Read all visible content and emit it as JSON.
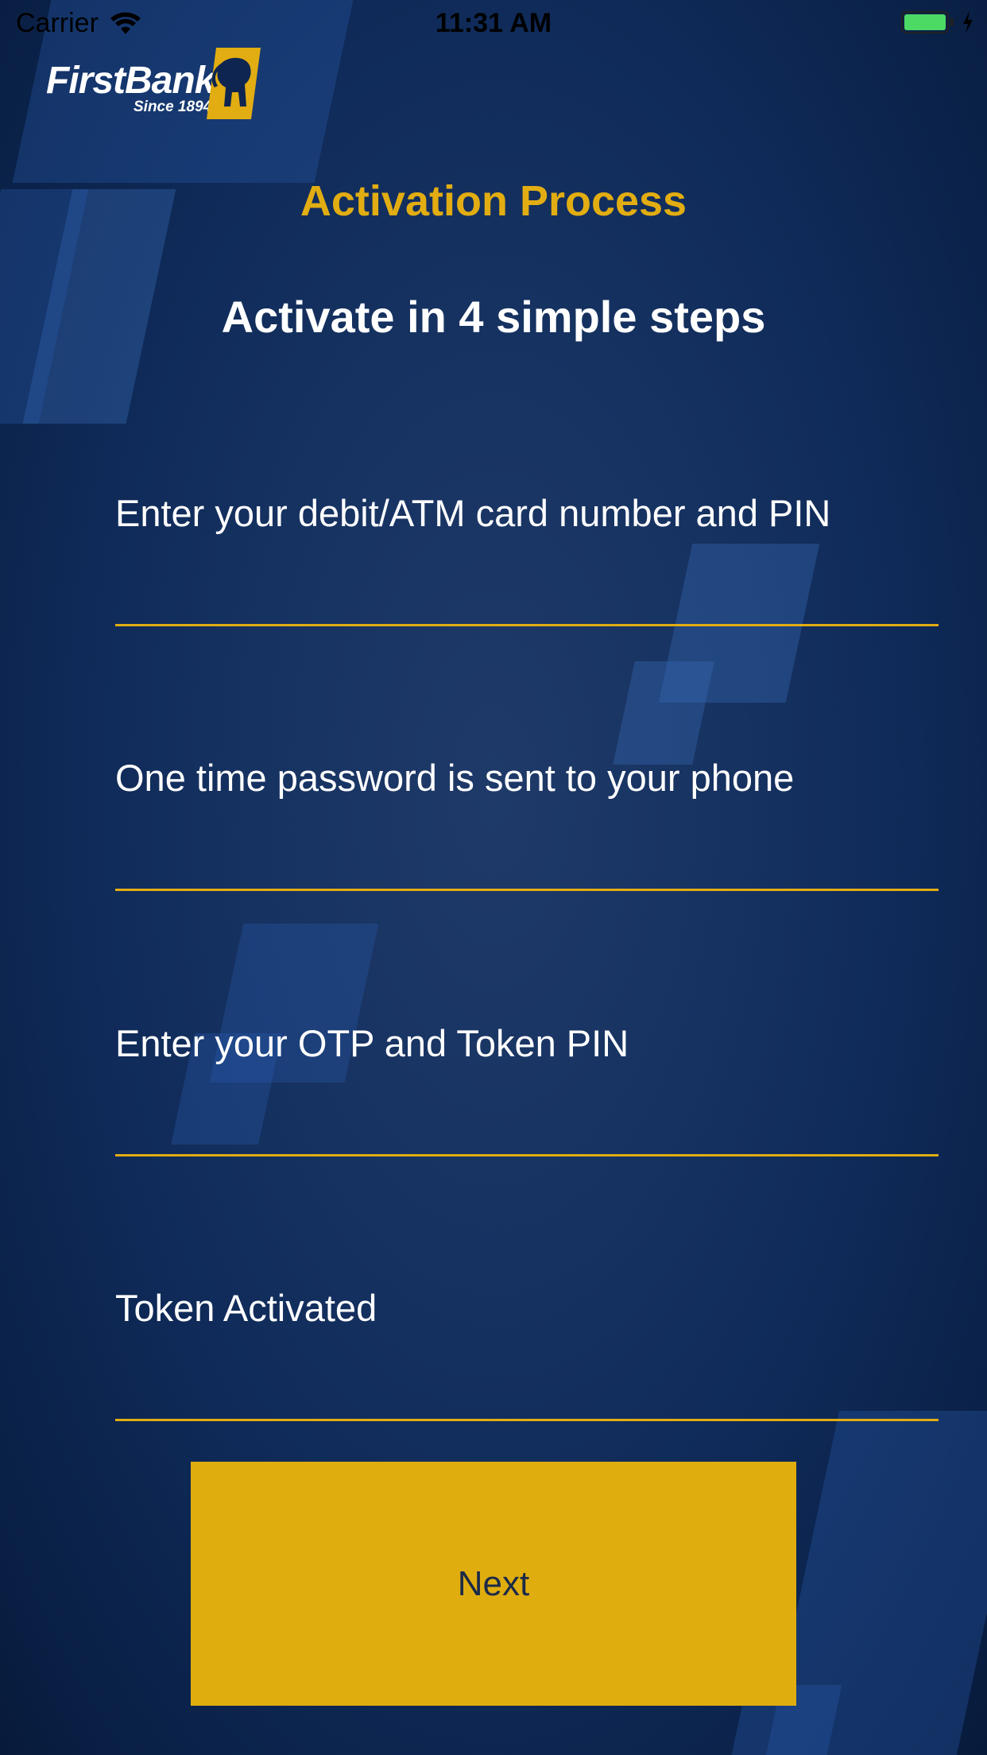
{
  "status_bar": {
    "carrier": "Carrier",
    "time": "11:31 AM",
    "battery_color": "#4cd964"
  },
  "logo": {
    "name": "FirstBank",
    "tagline": "Since 1894"
  },
  "header": {
    "title": "Activation Process",
    "subtitle": "Activate in 4 simple steps"
  },
  "steps": [
    {
      "label": "Enter your debit/ATM card number and PIN"
    },
    {
      "label": "One time password is sent to your phone"
    },
    {
      "label": "Enter your OTP and Token PIN"
    },
    {
      "label": "Token Activated"
    }
  ],
  "actions": {
    "next_label": "Next"
  },
  "colors": {
    "accent": "#e2ad12",
    "background": "#163261",
    "button": "#e0ad0f"
  },
  "icons": {
    "wifi": "wifi-icon",
    "battery": "battery-icon",
    "charging": "bolt-icon",
    "logo": "elephant-emblem-icon"
  }
}
